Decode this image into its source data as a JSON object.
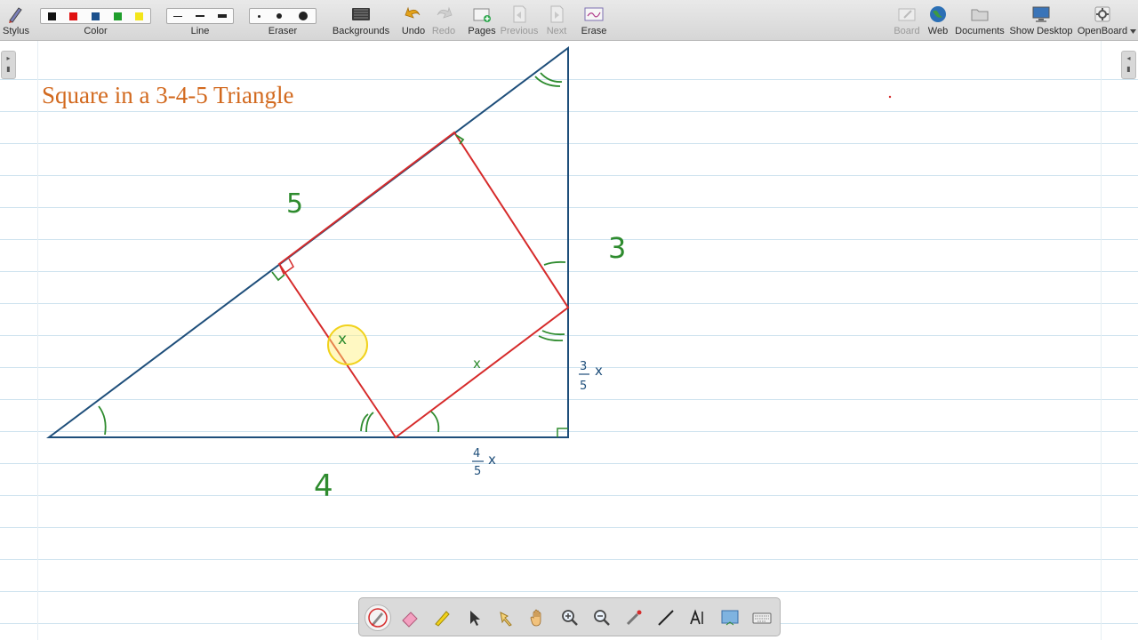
{
  "toolbar": {
    "stylus": "Stylus",
    "color": "Color",
    "line": "Line",
    "eraser": "Eraser",
    "backgrounds": "Backgrounds",
    "undo": "Undo",
    "redo": "Redo",
    "pages": "Pages",
    "previous": "Previous",
    "next": "Next",
    "erase": "Erase",
    "board": "Board",
    "web": "Web",
    "documents": "Documents",
    "show_desktop": "Show Desktop",
    "openboard": "OpenBoard"
  },
  "colors": {
    "black": "#111111",
    "red": "#e01010",
    "blue": "#1a4f8c",
    "green": "#1f9e2c",
    "yellow": "#f3e51a",
    "title": "#d2691e",
    "triangle": "#1e4e7a",
    "square": "#d62b2b",
    "annotation_green": "#2e8b2e"
  },
  "board": {
    "title": "Square in a 3-4-5 Triangle",
    "labels": {
      "hyp": "5",
      "vertical": "3",
      "base": "4",
      "x_side": "x",
      "x_bottom": "x",
      "frac_35_num": "3",
      "frac_35_den": "5",
      "frac_35_var": "x",
      "frac_45_num": "4",
      "frac_45_den": "5",
      "frac_45_var": "x"
    }
  },
  "palette_tools": [
    "pen-icon",
    "eraser-icon",
    "highlighter-icon",
    "selector-icon",
    "pointer-icon",
    "hand-icon",
    "zoom-in-icon",
    "zoom-out-icon",
    "laser-icon",
    "line-icon",
    "text-icon",
    "capture-icon",
    "keyboard-icon"
  ]
}
